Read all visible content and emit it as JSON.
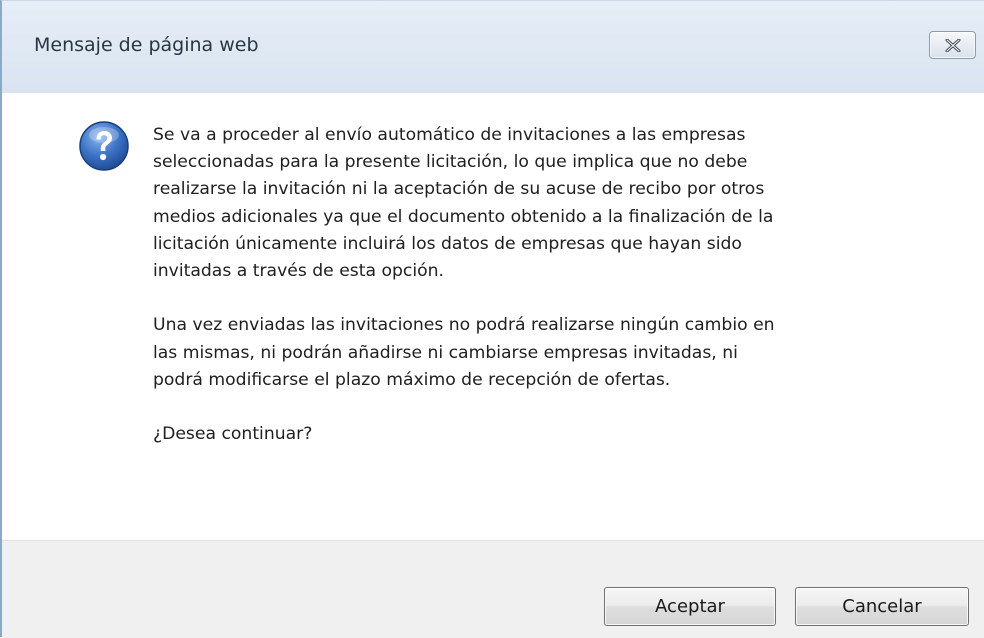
{
  "dialog": {
    "title": "Mensaje de página web",
    "icon": "question-icon",
    "paragraphs": [
      "Se va a proceder al envío automático de invitaciones a las empresas\nseleccionadas para la presente licitación, lo que implica que no debe\nrealizarse la invitación ni la aceptación de su acuse de recibo por otros\nmedios adicionales ya que el documento obtenido a la finalización de la\nlicitación únicamente incluirá los datos de empresas que hayan sido\ninvitadas a través de esta opción.",
      "Una vez enviadas las invitaciones no podrá realizarse ningún cambio en\nlas mismas, ni podrán añadirse ni cambiarse empresas invitadas, ni\npodrá modificarse el plazo máximo de recepción de ofertas.",
      "¿Desea continuar?"
    ],
    "buttons": {
      "accept_label": "Aceptar",
      "cancel_label": "Cancelar"
    },
    "colors": {
      "titlebar": "#dfe8f2",
      "footer": "#f0f0f0",
      "icon_blue": "#2f63b0"
    }
  }
}
